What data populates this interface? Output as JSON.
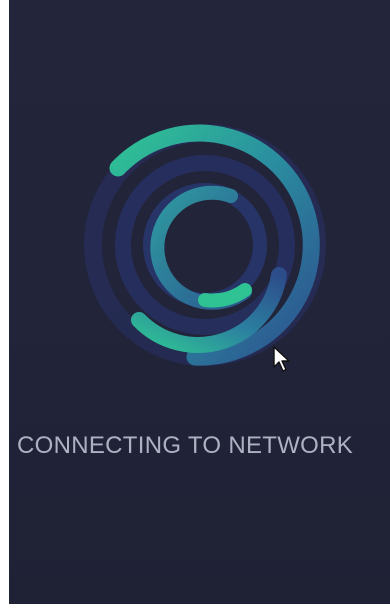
{
  "status": {
    "message": "CONNECTING TO NETWORK"
  },
  "colors": {
    "background": "#22243a",
    "ring_dark": "#2a3770",
    "ring_mid": "#2b4d8a",
    "accent_teal": "#2fbf8f",
    "text": "#aeb1c2"
  },
  "icons": {
    "spinner": "loading-rings-icon",
    "cursor": "mouse-pointer-icon"
  }
}
